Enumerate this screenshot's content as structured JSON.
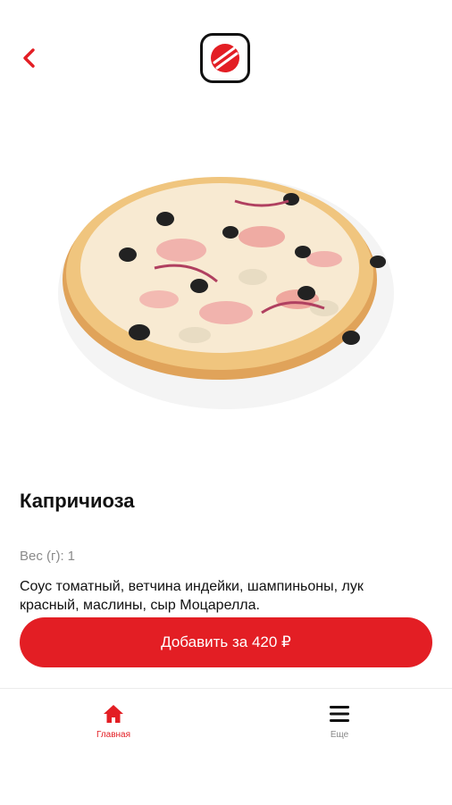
{
  "product": {
    "title": "Капричиоза",
    "weight_label": "Вес (г):",
    "weight_value": "1",
    "description": "Соус томатный, ветчина индейки, шампиньоны, лук красный, маслины, сыр Моцарелла.",
    "add_button_label": "Добавить за 420 ₽"
  },
  "nav": {
    "items": [
      {
        "label": "Главная",
        "icon": "home-icon",
        "active": true
      },
      {
        "label": "Еще",
        "icon": "menu-icon",
        "active": false
      }
    ]
  },
  "colors": {
    "accent": "#e31e24",
    "inactive": "#8a8a8a",
    "text": "#111111"
  },
  "icons": {
    "back": "chevron-left-icon",
    "logo": "brand-logo-icon"
  }
}
